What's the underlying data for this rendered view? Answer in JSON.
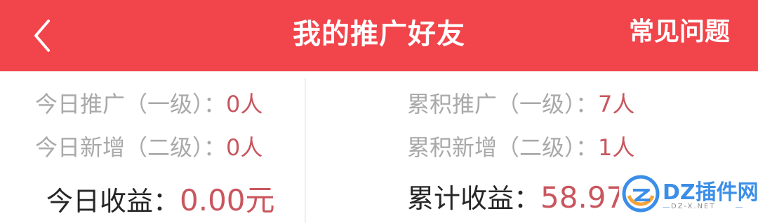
{
  "header": {
    "title": "我的推广好友",
    "faq_label": "常见问题",
    "bg_color": "#f2444b"
  },
  "today": {
    "level1_label": "今日推广（一级）：",
    "level1_value": "0人",
    "level2_label": "今日新增（二级）：",
    "level2_value": "0人",
    "income_label": "今日收益：",
    "income_value": "0.00元"
  },
  "total": {
    "level1_label": "累积推广（一级）：",
    "level1_value": "7人",
    "level2_label": "累积新增（二级）：",
    "level2_value": "1人",
    "income_label": "累计收益：",
    "income_value": "58.97"
  },
  "watermark": {
    "text": "DZ插件网",
    "domain": "DZ-X.NET"
  },
  "colors": {
    "accent": "#f2444b",
    "value": "#c9565e",
    "muted_label": "#a9a9a9",
    "strong_label": "#262626"
  }
}
